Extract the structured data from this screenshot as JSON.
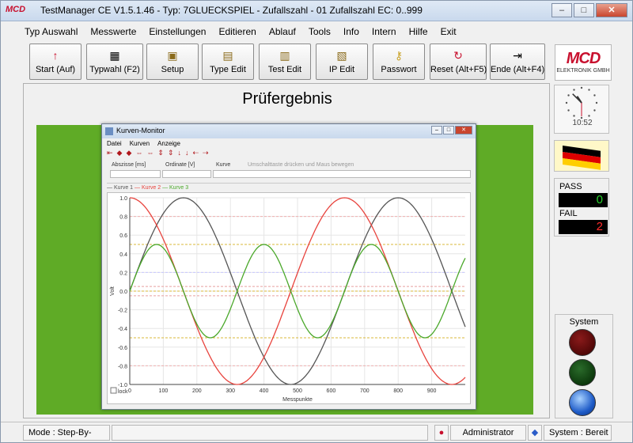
{
  "app": {
    "logo": "MCD",
    "title": "TestManager CE  V1.5.1.46 - Typ: 7GLUECKSPIEL - Zufallszahl - 01 Zufallszahl EC: 0..999",
    "window_buttons": [
      "–",
      "□",
      "✕"
    ]
  },
  "menu": [
    "Typ Auswahl",
    "Messwerte",
    "Einstellungen",
    "Editieren",
    "Ablauf",
    "Tools",
    "Info",
    "Intern",
    "Hilfe",
    "Exit"
  ],
  "toolbar": [
    {
      "label": "Start (Auf)",
      "icon": "↑"
    },
    {
      "label": "Typwahl (F2)",
      "icon": "▦"
    },
    {
      "label": "Setup",
      "icon": "▣"
    },
    {
      "label": "Type Edit",
      "icon": "▤"
    },
    {
      "label": "Test Edit",
      "icon": "▥"
    },
    {
      "label": "IP Edit",
      "icon": "▧"
    },
    {
      "label": "Passwort",
      "icon": "⚷"
    },
    {
      "label": "Reset (Alt+F5)",
      "icon": "↻"
    },
    {
      "label": "Ende (Alt+F4)",
      "icon": "⇥"
    }
  ],
  "brand": {
    "name": "MCD",
    "sub": "ELEKTRONIK GMBH"
  },
  "result_title": "Prüfergebnis",
  "kurven_monitor": {
    "title": "Kurven-Monitor",
    "menu": [
      "Datei",
      "Kurven",
      "Anzeige"
    ],
    "tool_icons": [
      "⇤",
      "◆",
      "◆",
      "⇔",
      "⇔",
      "⇕",
      "⇕",
      "↓",
      "↓",
      "⇠",
      "⇢"
    ],
    "field_labels": [
      "Abszisse [ms]",
      "Ordinate [V]",
      "Kurve",
      "Umschalttaste drücken und Maus bewegen"
    ],
    "legend": [
      {
        "name": "Kurve 1",
        "color": "#555555"
      },
      {
        "name": "Kurve 2",
        "color": "#e8433d"
      },
      {
        "name": "Kurve 3",
        "color": "#4aa82a"
      }
    ],
    "lock_label": "lock"
  },
  "chart_data": {
    "type": "line",
    "xlabel": "Messpunkte",
    "ylabel": "Volt",
    "xlim": [
      0,
      1000
    ],
    "ylim": [
      -1.0,
      1.0
    ],
    "x_ticks": [
      0,
      100,
      200,
      300,
      400,
      500,
      600,
      700,
      800,
      900
    ],
    "y_ticks": [
      1.0,
      0.8,
      0.6,
      0.4,
      0.2,
      0.0,
      -0.2,
      -0.4,
      -0.6,
      -0.8,
      -1.0
    ],
    "series": [
      {
        "name": "Kurve 1",
        "color": "#555555",
        "amplitude": 1.0,
        "period": 640,
        "phase": 0,
        "func": "sin"
      },
      {
        "name": "Kurve 2",
        "color": "#e8433d",
        "amplitude": 1.0,
        "period": 640,
        "phase": 0,
        "func": "cos"
      },
      {
        "name": "Kurve 3",
        "color": "#4aa82a",
        "amplitude": 0.5,
        "period": 320,
        "phase": 0,
        "func": "sin"
      }
    ],
    "ref_lines": [
      {
        "y": 0.5,
        "color": "#d9b83a"
      },
      {
        "y": 0.2,
        "color": "#c8c8ff"
      },
      {
        "y": 0.05,
        "color": "#e8a0a0"
      },
      {
        "y": 0.0,
        "color": "#d9b83a"
      },
      {
        "y": -0.05,
        "color": "#e8a0a0"
      },
      {
        "y": -0.5,
        "color": "#d9b83a"
      },
      {
        "y": 0.8,
        "color": "#f0b0b0"
      },
      {
        "y": -0.8,
        "color": "#f0b0b0"
      }
    ],
    "grid": true
  },
  "clock": {
    "time": "10:52",
    "hour": 10,
    "minute": 52,
    "second": 30
  },
  "counters": {
    "pass_label": "PASS",
    "pass_value": "0",
    "fail_label": "FAIL",
    "fail_value": "2",
    "pass_color": "#27d22b",
    "fail_color": "#ff2b2b"
  },
  "system": {
    "label": "System",
    "lamps": [
      {
        "name": "red",
        "active": false
      },
      {
        "name": "green",
        "active": false
      },
      {
        "name": "blue",
        "active": true
      }
    ]
  },
  "status": {
    "mode": "Mode : Step-By-Step",
    "user": "Administrator",
    "system_state": "System : Bereit"
  }
}
